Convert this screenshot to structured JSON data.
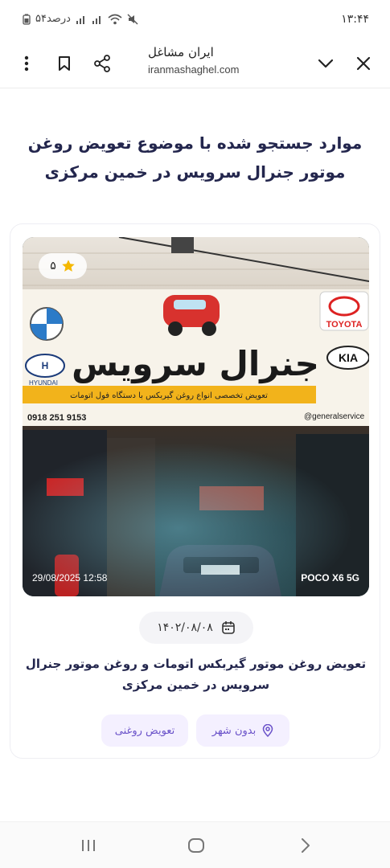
{
  "status": {
    "time": "۱۳:۴۴",
    "battery_text": "۵۴درصد"
  },
  "browser": {
    "site_title": "ایران مشاغل",
    "site_url": "iranmashaghel.com",
    "icons": [
      "more-vert-icon",
      "bookmark-icon",
      "share-icon",
      "chevron-down-icon",
      "close-icon"
    ]
  },
  "page": {
    "heading": "موارد جستجو شده با موضوع تعویض روغن موتور جنرال سرویس در خمین مرکزی"
  },
  "card": {
    "rating": "۵",
    "photo_timestamp": "29/08/2025 12:58",
    "photo_device": "POCO X6 5G",
    "sign_text": "جنرال سرویس",
    "sign_subtext": "تعویض تخصصی انواع روغن گیربکس با دستگاه فول اتومات",
    "sign_phone": "0918 251 9153",
    "sign_instagram": "@generalservice",
    "sign_brand_toyota": "TOYOTA",
    "sign_brand_kia": "KIA",
    "sign_brand_hyundai": "HYUNDAI",
    "date": "۱۴۰۲/۰۸/۰۸",
    "title": "تعویض روغن موتور گیربکس اتومات و روغن موتور جنرال سرویس در خمین مرکزی",
    "tags": [
      {
        "label": "بدون شهر",
        "icon": "location-pin-icon"
      },
      {
        "label": "تعویض روغنی"
      }
    ]
  },
  "colors": {
    "heading": "#23264d",
    "tag_bg": "#f4f0ff",
    "tag_text": "#6a52c9",
    "star": "#f5b800"
  }
}
